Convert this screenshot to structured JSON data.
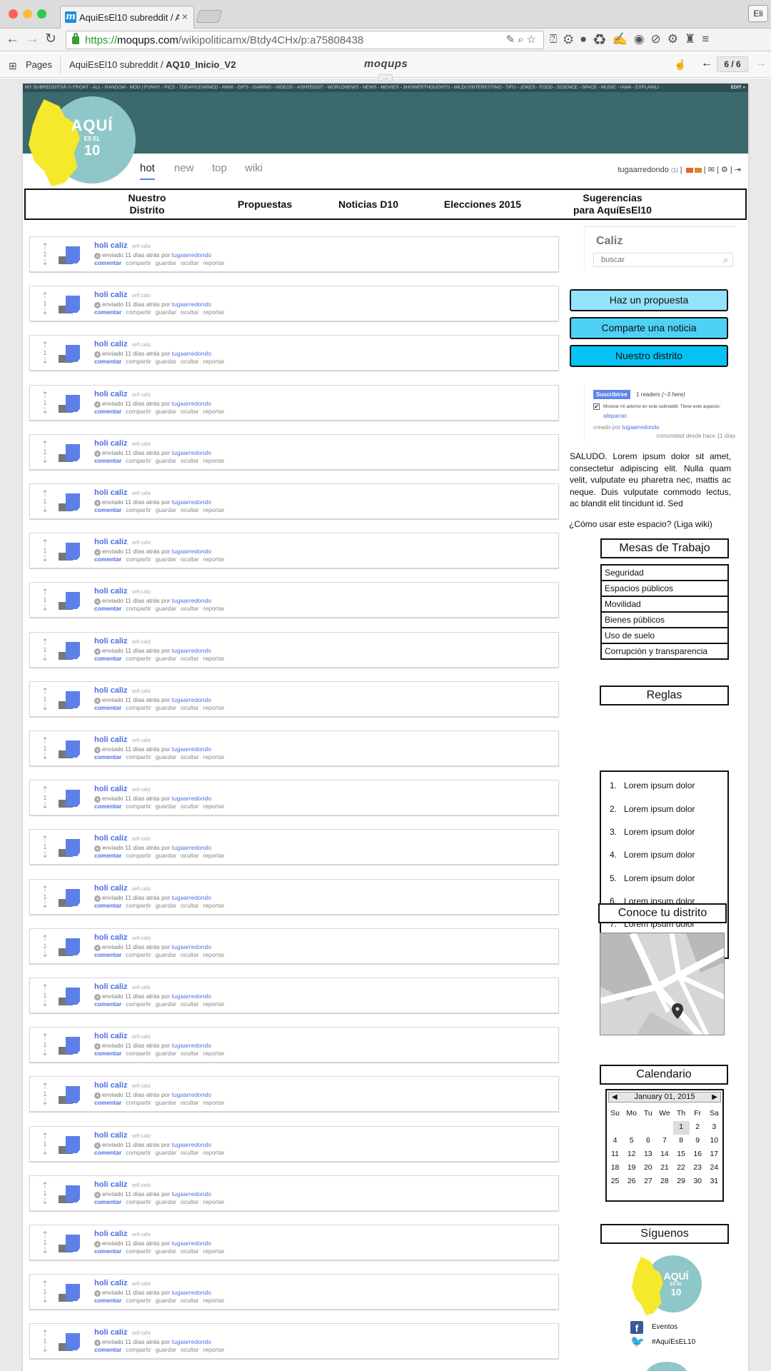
{
  "browser": {
    "tab_title": "AquiEsEl10 subreddit / AQ",
    "tab_favicon": "m",
    "tab_close": "×",
    "profile": "Eli",
    "url": {
      "scheme": "https://",
      "host": "moqups.com",
      "path": "/wikipoliticamx/Btdy4CHx/p:a75808438"
    }
  },
  "app": {
    "pages_label": "Pages",
    "breadcrumb_project": "AquiEsEl10 subreddit /",
    "breadcrumb_page": "AQ10_Inicio_V2",
    "logo": "moqups",
    "page_counter": "6 / 6"
  },
  "reddit": {
    "topbar_links": "MY SUBREDDITSÂ·¼   FRONT - ALL - RANDOM - MOD  |  FUNNY - PICS - TODAYILEARNED - AWW - GIFS - GAMING - VIDEOS - ASKREDDIT - WORLDNEWS - NEWS - MOVIES - SHOWERTHOUGHTS - MILDLYINTERESTING - TIFU - JOKES - FOOD - SCIENCE - SPACE - MUSIC - IAMA - EXPLAINLI",
    "topbar_edit": "EDIT »",
    "logo": {
      "line1": "AQUÍ",
      "line2": "ES EL",
      "line3": "10"
    },
    "tabs": [
      "hot",
      "new",
      "top",
      "wiki"
    ],
    "active_tab": "hot",
    "user": "tugaarredondo",
    "user_karma": "(1)",
    "colors": {
      "banner": "#3c6a6c",
      "topbar": "#2f4f54",
      "logo_yellow": "#f4e92b",
      "logo_circle": "#8fc7c9",
      "link_blue": "#4d6ee6"
    }
  },
  "site_nav": [
    "Nuestro\nDistrito",
    "Propuestas",
    "Noticias D10",
    "Elecciones 2015",
    "Sugerencias\npara AquíEsEl10"
  ],
  "post_template": {
    "votes": "1",
    "title": "holi caliz",
    "domain": "self.caliz",
    "submitted": "enviado 11 días atrás por",
    "author": "tugaarredondo",
    "actions": [
      "comentar",
      "compartir",
      "guardar",
      "ocultar",
      "reportar"
    ]
  },
  "post_count": 23,
  "sidebar": {
    "search_title": "Caliz",
    "search_placeholder": "buscar",
    "cta_buttons": [
      {
        "label": "Haz un propuesta",
        "color": "#93e3fb"
      },
      {
        "label": "Comparte una noticia",
        "color": "#4fd0f5"
      },
      {
        "label": "Nuestro distrito",
        "color": "#06c1f4"
      }
    ],
    "subscribe": {
      "button": "Suscribirse",
      "readers": "1 readers",
      "here": "(~3 here)",
      "show_flair": "Mostrar mi adorno en este subreddit. Tiene este aspecto:",
      "flair_user": "aleparrac",
      "created_by": "creado por",
      "creator": "tugaarredondo",
      "since": "comunidad desde hace 11 días"
    },
    "greeting": "SALUDO. Lorem ipsum dolor sit amet, consectetur adipiscing elit. Nulla quam velit, vulputate eu pharetra nec, mattis ac neque. Duis vulputate commodo lectus, ac blandit elit tincidunt id. Sed",
    "wiki_link": "¿Cómo usar este espacio? (Liga wiki)",
    "mesas_title": "Mesas de Trabajo",
    "mesas": [
      "Seguridad",
      "Espacios públicos",
      "Movilidad",
      "Bienes públicos",
      "Uso de suelo",
      "Corrupción y transparencia"
    ],
    "reglas_title": "Reglas",
    "reglas": [
      "Lorem ipsum dolor",
      "Lorem ipsum dolor",
      "Lorem ipsum dolor",
      "Lorem ipsum dolor",
      "Lorem ipsum dolor",
      "Lorem ipsum dolor",
      "Lorem ipsum dolor"
    ],
    "distrito_title": "Conoce tu distrito",
    "calendar_title": "Calendario",
    "calendar": {
      "header": "January 01, 2015",
      "weekdays": [
        "Su",
        "Mo",
        "Tu",
        "We",
        "Th",
        "Fr",
        "Sa"
      ],
      "weeks": [
        [
          "",
          "",
          "",
          "",
          "1",
          "2",
          "3"
        ],
        [
          "4",
          "5",
          "6",
          "7",
          "8",
          "9",
          "10"
        ],
        [
          "11",
          "12",
          "13",
          "14",
          "15",
          "16",
          "17"
        ],
        [
          "18",
          "19",
          "20",
          "21",
          "22",
          "23",
          "24"
        ],
        [
          "25",
          "26",
          "27",
          "28",
          "29",
          "30",
          "31"
        ]
      ],
      "selected": "1"
    },
    "follow_title": "Síguenos",
    "social": [
      {
        "icon": "facebook-icon",
        "label": "Eventos"
      },
      {
        "icon": "twitter-icon",
        "label": "#AquíEsEL10"
      }
    ]
  }
}
